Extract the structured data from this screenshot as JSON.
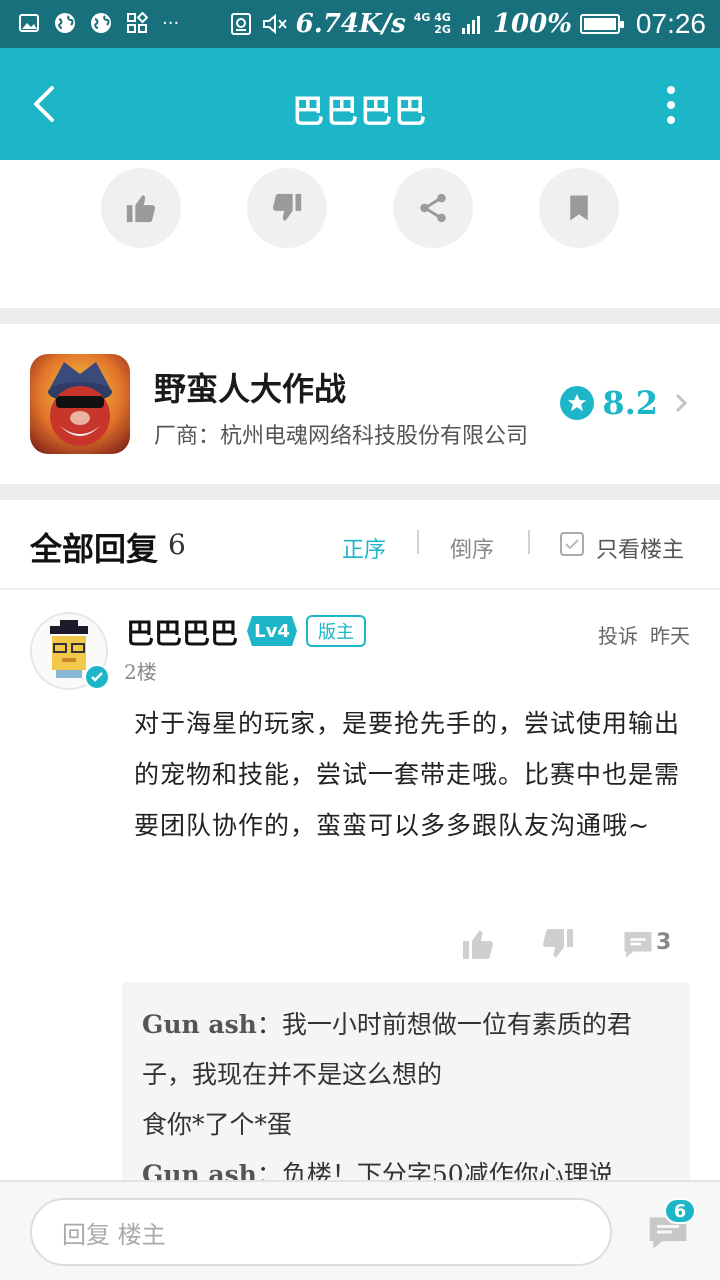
{
  "status_bar": {
    "net_speed": "6.74K/s",
    "net_type_top": "4G 4G",
    "net_type_bottom": "2G",
    "battery_pct": "100%",
    "battery_level": 1.0,
    "time": "07:26",
    "overflow": "···",
    "icons": [
      "gallery-icon",
      "globe-icon",
      "globe-icon",
      "app-grid-icon",
      "nfc-icon",
      "mute-icon",
      "signal-icon",
      "battery-icon"
    ]
  },
  "app_bar": {
    "title": "巴巴巴巴",
    "icons": [
      "back-arrow-icon",
      "more-vertical-icon"
    ]
  },
  "actions": {
    "icons": [
      "thumbs-up-icon",
      "thumbs-down-icon",
      "share-icon",
      "bookmark-icon"
    ]
  },
  "game": {
    "name": "野蛮人大作战",
    "vendor": "厂商：杭州电魂网络科技股份有限公司",
    "rating": "8.2",
    "icons": [
      "star-icon",
      "chevron-right-icon"
    ]
  },
  "replies_header": {
    "title": "全部回复",
    "count": "6",
    "sort_asc": "正序",
    "sort_desc": "倒序",
    "owner_only": "只看楼主"
  },
  "comment": {
    "author": "巴巴巴巴",
    "level": "Lv4",
    "role": "版主",
    "floor": "2楼",
    "report": "投诉",
    "time": "昨天",
    "body": "对于海星的玩家，是要抢先手的，尝试使用输出的宠物和技能，尝试一套带走哦。比赛中也是需要团队协作的，蛮蛮可以多多跟队友沟通哦~",
    "reply_count": "3",
    "sub_replies": [
      {
        "author": "Gun ash",
        "text": "：我一小时前想做一位有素质的君子，我现在并不是这么想的"
      },
      {
        "author": "",
        "text": "食你*了个*蛋"
      },
      {
        "author": "Gun ash",
        "text": "：负楼！下分字50减作你心理说"
      }
    ]
  },
  "bottom_bar": {
    "placeholder": "回复 楼主",
    "badge": "6"
  },
  "colors": {
    "primary": "#1cb6c8",
    "status_bar": "#17707c"
  }
}
